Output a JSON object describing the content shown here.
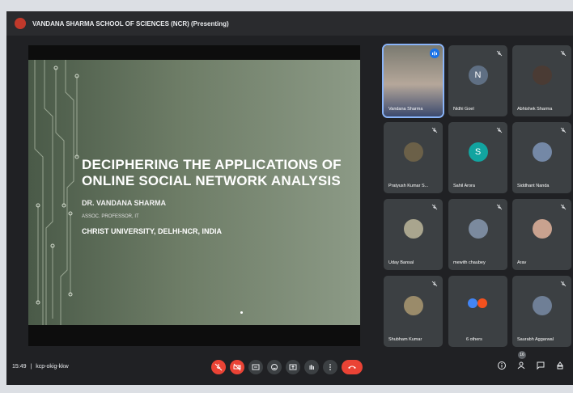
{
  "topbar": {
    "title": "VANDANA SHARMA SCHOOL OF SCIENCES (NCR) (Presenting)"
  },
  "slide": {
    "title_line1": "DECIPHERING THE APPLICATIONS OF",
    "title_line2": "ONLINE SOCIAL NETWORK ANALYSIS",
    "author": "DR. VANDANA SHARMA",
    "role": "ASSOC. PROFESSOR, IT",
    "institution": "CHRIST UNIVERSITY, DELHI-NCR, INDIA"
  },
  "participants": [
    {
      "name": "Vandana Sharma",
      "avatar_type": "video",
      "color": "#8d7b6e"
    },
    {
      "name": "Nidhi Goel",
      "avatar_type": "letter",
      "letter": "N",
      "color": "#5f6f83"
    },
    {
      "name": "Abhishek Sharma",
      "avatar_type": "photo",
      "color": "#4a3b34"
    },
    {
      "name": "Pratyush Kumar S...",
      "avatar_type": "photo",
      "color": "#6b6048"
    },
    {
      "name": "Sahil Arora",
      "avatar_type": "letter",
      "letter": "S",
      "color": "#12a4a0"
    },
    {
      "name": "Siddhant Nanda",
      "avatar_type": "photo",
      "color": "#7488a6"
    },
    {
      "name": "Uday Bansal",
      "avatar_type": "photo",
      "color": "#a9a58e"
    },
    {
      "name": "mewith chaubey",
      "avatar_type": "photo",
      "color": "#7b8a9e"
    },
    {
      "name": "Arav",
      "avatar_type": "photo",
      "color": "#c9a28f"
    },
    {
      "name": "Shubham Kumar",
      "avatar_type": "photo",
      "color": "#9a8b6a"
    },
    {
      "name": "6 others",
      "avatar_type": "group",
      "color": "#4285f4"
    },
    {
      "name": "Saurabh Aggarwal",
      "avatar_type": "photo",
      "color": "#6f7f96"
    }
  ],
  "bottombar": {
    "time": "15:49",
    "separator": "|",
    "meeting_code": "kcp-okig-kkw",
    "people_count": "16"
  },
  "colors": {
    "accent": "#8ab4f8",
    "danger": "#ea4335",
    "tile_bg": "#3c4043"
  }
}
